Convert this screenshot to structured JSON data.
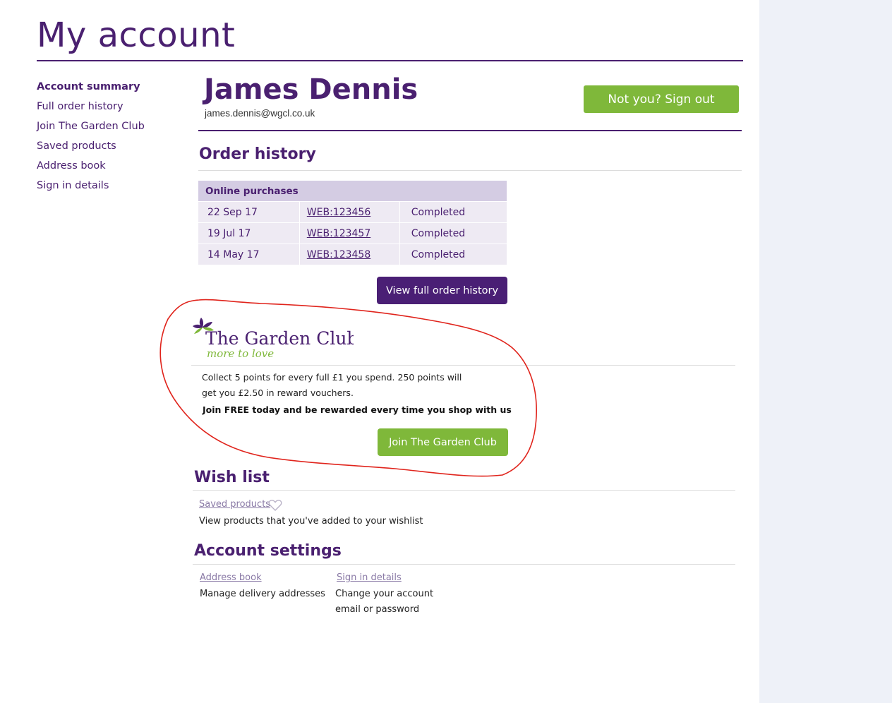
{
  "page": {
    "title": "My account"
  },
  "sidebar": {
    "items": [
      {
        "label": "Account summary",
        "active": true
      },
      {
        "label": "Full order history"
      },
      {
        "label": "Join The Garden Club"
      },
      {
        "label": "Saved products"
      },
      {
        "label": "Address book"
      },
      {
        "label": "Sign in details"
      }
    ]
  },
  "user": {
    "name": "James Dennis",
    "email": "james.dennis@wgcl.co.uk",
    "signout_label": "Not you? Sign out"
  },
  "order_history": {
    "heading": "Order history",
    "table_header": "Online purchases",
    "rows": [
      {
        "date": "22 Sep 17",
        "order": "WEB:123456",
        "status": "Completed"
      },
      {
        "date": "19 Jul 17",
        "order": "WEB:123457",
        "status": "Completed"
      },
      {
        "date": "14 May 17",
        "order": "WEB:123458",
        "status": "Completed"
      }
    ],
    "button_label": "View full order history"
  },
  "garden_club": {
    "logo_name": "The Garden Club",
    "logo_tagline": "more to love",
    "description": "Collect 5 points for every full £1 you spend. 250 points will get you £2.50 in reward vouchers.",
    "callout": "Join FREE today and be rewarded every time you shop with us",
    "button_label": "Join The Garden Club"
  },
  "wish_list": {
    "heading": "Wish list",
    "link_label": "Saved products",
    "description": "View products that you've added to your wishlist"
  },
  "account_settings": {
    "heading": "Account settings",
    "address_link": "Address book",
    "address_desc": "Manage delivery addresses",
    "signin_link": "Sign in details",
    "signin_desc": "Change your account email or password"
  },
  "colors": {
    "brand_purple": "#4a2070",
    "accent_green": "#7fb83a",
    "annotation_red": "#e0241c",
    "side_panel": "#eef1f8"
  }
}
